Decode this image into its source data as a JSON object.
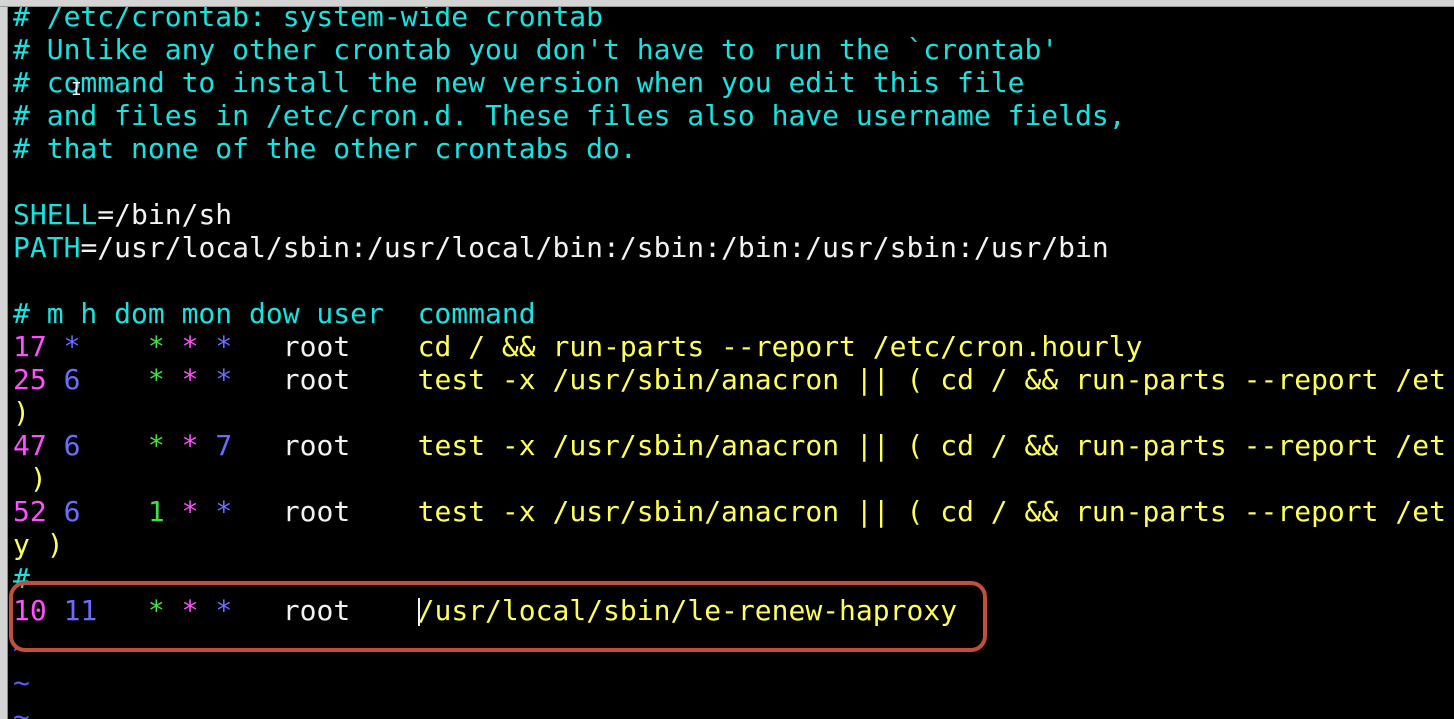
{
  "editor": {
    "comments": [
      "# /etc/crontab: system-wide crontab",
      "# Unlike any other crontab you don't have to run the `crontab'",
      "# command to install the new version when you edit this file",
      "# and files in /etc/cron.d. These files also have username fields,",
      "# that none of the other crontabs do."
    ],
    "shell_key": "SHELL",
    "shell_eq": "=",
    "shell_val": "/bin/sh",
    "path_key": "PATH",
    "path_eq": "=",
    "path_val": "/usr/local/sbin:/usr/local/bin:/sbin:/bin:/usr/sbin:/usr/bin",
    "header": "# m h dom mon dow user  command",
    "entries": [
      {
        "m": "17",
        "h": "*",
        "dom": "*",
        "mon": "*",
        "dow": "*",
        "user": "root",
        "command": "cd / && run-parts --report /etc/cron.hourly",
        "wrap": ""
      },
      {
        "m": "25",
        "h": "6",
        "dom": "*",
        "mon": "*",
        "dow": "*",
        "user": "root",
        "command": "test -x /usr/sbin/anacron || ( cd / && run-parts --report /et",
        "wrap": ")"
      },
      {
        "m": "47",
        "h": "6",
        "dom": "*",
        "mon": "*",
        "dow": "7",
        "user": "root",
        "command": "test -x /usr/sbin/anacron || ( cd / && run-parts --report /et",
        "wrap": " )"
      },
      {
        "m": "52",
        "h": "6",
        "dom": "1",
        "mon": "*",
        "dow": "*",
        "user": "root",
        "command": "test -x /usr/sbin/anacron || ( cd / && run-parts --report /et",
        "wrap": "y )"
      }
    ],
    "separator": "#",
    "new_entry": {
      "m": "10",
      "h": "11",
      "dom": "*",
      "mon": "*",
      "dow": "*",
      "user": "root",
      "command": "/usr/local/sbin/le-renew-haproxy"
    },
    "tilde": "~"
  },
  "colors": {
    "comment": "#17e3e3",
    "minute": "#ff4fff",
    "hour": "#6c6cff",
    "day_of_month": "#3fe33f",
    "command": "#ffff5a",
    "highlight_box": "#c0503c"
  }
}
